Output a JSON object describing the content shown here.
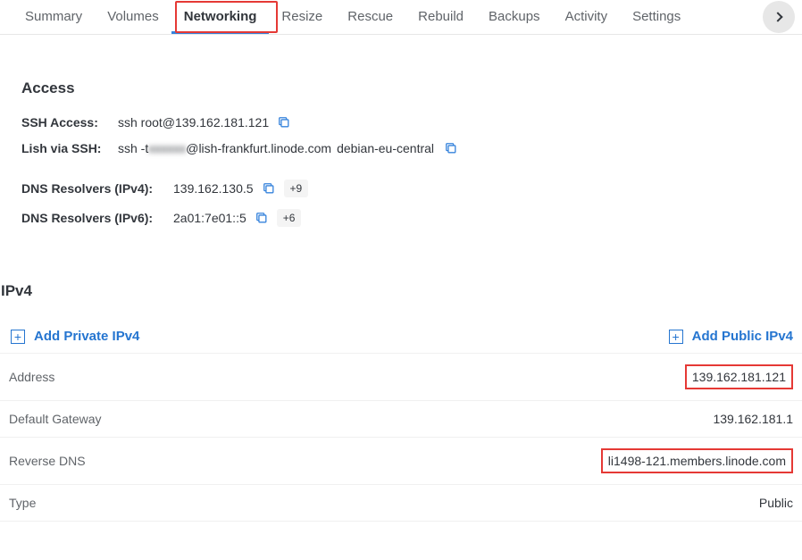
{
  "tabs": {
    "items": [
      "Summary",
      "Volumes",
      "Networking",
      "Resize",
      "Rescue",
      "Rebuild",
      "Backups",
      "Activity",
      "Settings"
    ],
    "activeIndex": 2
  },
  "access": {
    "title": "Access",
    "ssh": {
      "label": "SSH Access:",
      "value": "ssh root@139.162.181.121"
    },
    "lish": {
      "label": "Lish via SSH:",
      "prefix": "ssh -t ",
      "user_redacted": "xxxxxx",
      "host": "@lish-frankfurt.linode.com",
      "arg": "debian-eu-central"
    },
    "dns_v4": {
      "label": "DNS Resolvers (IPv4):",
      "value": "139.162.130.5",
      "more": "+9"
    },
    "dns_v6": {
      "label": "DNS Resolvers (IPv6):",
      "value": "2a01:7e01::5",
      "more": "+6"
    }
  },
  "ipv4": {
    "title": "IPv4",
    "add_private": "Add Private IPv4",
    "add_public": "Add Public IPv4",
    "rows": {
      "address": {
        "k": "Address",
        "v": "139.162.181.121"
      },
      "gateway": {
        "k": "Default Gateway",
        "v": "139.162.181.1"
      },
      "rdns": {
        "k": "Reverse DNS",
        "v": "li1498-121.members.linode.com"
      },
      "type": {
        "k": "Type",
        "v": "Public"
      }
    }
  }
}
